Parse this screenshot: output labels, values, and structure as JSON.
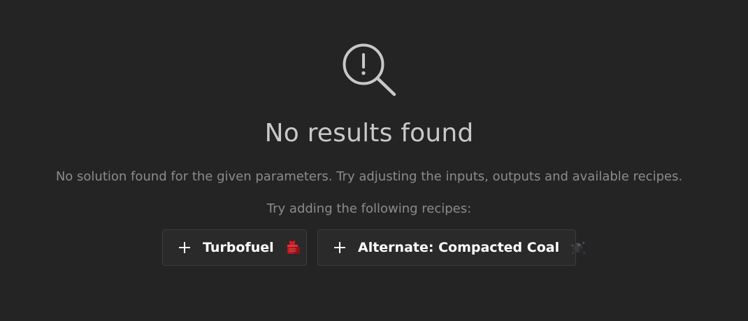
{
  "empty_state": {
    "icon": "search-alert-icon",
    "title": "No results found",
    "description": "No solution found for the given parameters. Try adjusting the inputs, outputs and available recipes.",
    "hint": "Try adding the following recipes:"
  },
  "suggestions": [
    {
      "label": "Turbofuel",
      "icon": "turbofuel-icon",
      "action_icon": "plus-icon"
    },
    {
      "label": "Alternate: Compacted Coal",
      "icon": "compacted-coal-icon",
      "action_icon": "plus-icon"
    }
  ],
  "colors": {
    "background": "#242424",
    "title": "#c9c9c9",
    "muted_text": "#8c8c8c",
    "button_bg": "#2a2a2a",
    "button_border": "#3c3c3c",
    "button_text": "#ffffff"
  }
}
